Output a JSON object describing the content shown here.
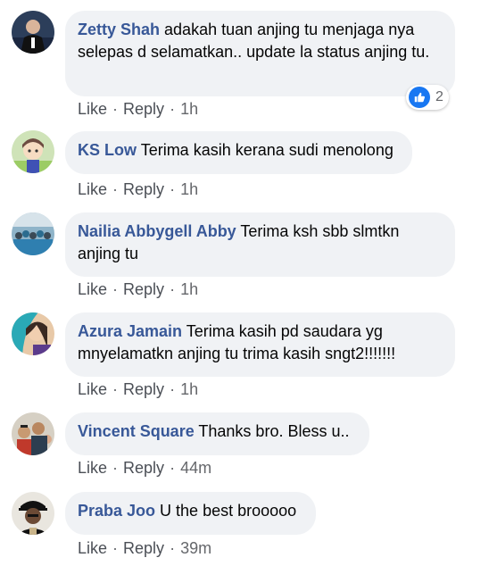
{
  "comments": [
    {
      "author": "Zetty Shah",
      "text": "adakah tuan anjing tu menjaga nya selepas d selamatkan.. update la status anjing tu.",
      "like": "Like",
      "reply": "Reply",
      "time": "1h",
      "reaction_count": "2",
      "reaction_icon": "like-icon"
    },
    {
      "author": "KS Low",
      "text": "Terima kasih kerana sudi menolong",
      "like": "Like",
      "reply": "Reply",
      "time": "1h"
    },
    {
      "author": "Nailia Abbygell Abby",
      "text": "Terima ksh sbb slmtkn anjing tu",
      "like": "Like",
      "reply": "Reply",
      "time": "1h"
    },
    {
      "author": "Azura Jamain",
      "text": "Terima kasih pd saudara yg mnyelamatkn anjing tu trima kasih sngt2!!!!!!!",
      "like": "Like",
      "reply": "Reply",
      "time": "1h"
    },
    {
      "author": "Vincent Square",
      "text": "Thanks bro. Bless u..",
      "like": "Like",
      "reply": "Reply",
      "time": "44m"
    },
    {
      "author": "Praba Joo",
      "text": "U the best brooooo",
      "like": "Like",
      "reply": "Reply",
      "time": "39m"
    }
  ],
  "colors": {
    "author": "#385898",
    "bubble": "#f0f2f5",
    "meta": "#65676b",
    "like_badge": "#1877f2"
  }
}
